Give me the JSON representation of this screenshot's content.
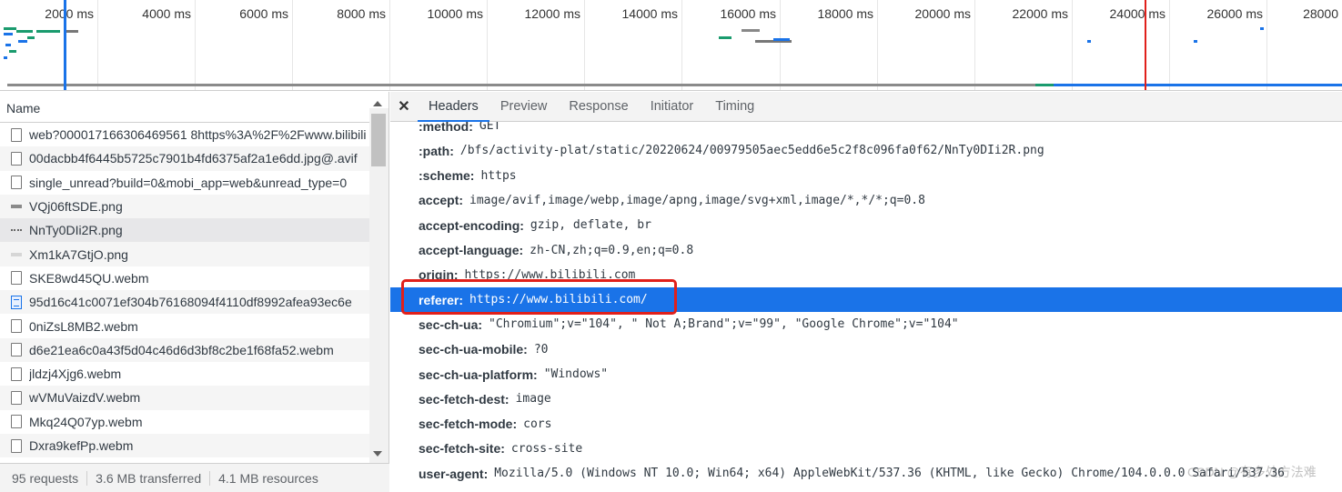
{
  "timeline": {
    "ticks": [
      "2000 ms",
      "4000 ms",
      "6000 ms",
      "8000 ms",
      "10000 ms",
      "12000 ms",
      "14000 ms",
      "16000 ms",
      "18000 ms",
      "20000 ms",
      "22000 ms",
      "24000 ms",
      "26000 ms",
      "28000"
    ],
    "dom_content_loaded_color": "#1a73e8",
    "load_color": "#e0201b"
  },
  "requests": {
    "column_header": "Name",
    "items": [
      {
        "name": "web?000017166306469561 8https%3A%2F%2Fwww.bilibili",
        "icon": "document-icon"
      },
      {
        "name": "00dacbb4f6445b5725c7901b4fd6375af2a1e6dd.jpg@.avif",
        "icon": "document-icon"
      },
      {
        "name": "single_unread?build=0&mobi_app=web&unread_type=0",
        "icon": "document-icon"
      },
      {
        "name": "VQj06ftSDE.png",
        "icon": "image-icon"
      },
      {
        "name": "NnTy0DIi2R.png",
        "icon": "image-icon"
      },
      {
        "name": "Xm1kA7GtjO.png",
        "icon": "image-icon"
      },
      {
        "name": "SKE8wd45QU.webm",
        "icon": "document-icon"
      },
      {
        "name": "95d16c41c0071ef304b76168094f4110df8992afea93ec6e",
        "icon": "script-icon"
      },
      {
        "name": "0niZsL8MB2.webm",
        "icon": "document-icon"
      },
      {
        "name": "d6e21ea6c0a43f5d04c46d6d3bf8c2be1f68fa52.webm",
        "icon": "document-icon"
      },
      {
        "name": "jldzj4Xjg6.webm",
        "icon": "document-icon"
      },
      {
        "name": "wVMuVaizdV.webm",
        "icon": "document-icon"
      },
      {
        "name": "Mkq24Q07yp.webm",
        "icon": "document-icon"
      },
      {
        "name": "Dxra9kefPp.webm",
        "icon": "document-icon"
      }
    ]
  },
  "status": {
    "requests": "95 requests",
    "transferred": "3.6 MB transferred",
    "resources": "4.1 MB resources"
  },
  "details": {
    "close_icon": "close-icon",
    "tabs": [
      "Headers",
      "Preview",
      "Response",
      "Initiator",
      "Timing"
    ],
    "active_tab": "Headers",
    "headers": [
      {
        "name": ":method:",
        "value": "GET"
      },
      {
        "name": ":path:",
        "value": "/bfs/activity-plat/static/20220624/00979505aec5edd6e5c2f8c096fa0f62/NnTy0DIi2R.png"
      },
      {
        "name": ":scheme:",
        "value": "https"
      },
      {
        "name": "accept:",
        "value": "image/avif,image/webp,image/apng,image/svg+xml,image/*,*/*;q=0.8"
      },
      {
        "name": "accept-encoding:",
        "value": "gzip, deflate, br"
      },
      {
        "name": "accept-language:",
        "value": "zh-CN,zh;q=0.9,en;q=0.8"
      },
      {
        "name": "origin:",
        "value": "https://www.bilibili.com"
      },
      {
        "name": "referer:",
        "value": "https://www.bilibili.com/"
      },
      {
        "name": "sec-ch-ua:",
        "value": "\"Chromium\";v=\"104\", \" Not A;Brand\";v=\"99\", \"Google Chrome\";v=\"104\""
      },
      {
        "name": "sec-ch-ua-mobile:",
        "value": "?0"
      },
      {
        "name": "sec-ch-ua-platform:",
        "value": "\"Windows\""
      },
      {
        "name": "sec-fetch-dest:",
        "value": "image"
      },
      {
        "name": "sec-fetch-mode:",
        "value": "cors"
      },
      {
        "name": "sec-fetch-site:",
        "value": "cross-site"
      },
      {
        "name": "user-agent:",
        "value": "Mozilla/5.0 (Windows NT 10.0; Win64; x64) AppleWebKit/537.36 (KHTML, like Gecko) Chrome/104.0.0.0 Safari/537.36"
      }
    ],
    "highlighted_header": "referer:",
    "highlight_color": "#1a73e8",
    "annotation_color": "#e0201b"
  },
  "watermark": "CSDN @有多处方法难"
}
